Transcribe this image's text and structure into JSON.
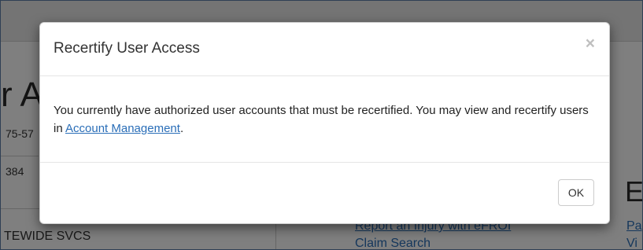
{
  "background": {
    "heading": "r A",
    "line1": "75-57",
    "line2": "384",
    "org": "TEWIDE SVCS",
    "links": {
      "report": "Report an Injury with eFROI",
      "claim": "Claim Search",
      "pa": "Pa",
      "vi": "Vi"
    },
    "section_letter": "E"
  },
  "modal": {
    "title": "Recertify User Access",
    "close_label": "×",
    "body_text_before": "You currently have authorized user accounts that must be recertified. You may view and recertify users in ",
    "body_link": "Account Management",
    "body_text_after": ".",
    "ok_label": "OK"
  }
}
